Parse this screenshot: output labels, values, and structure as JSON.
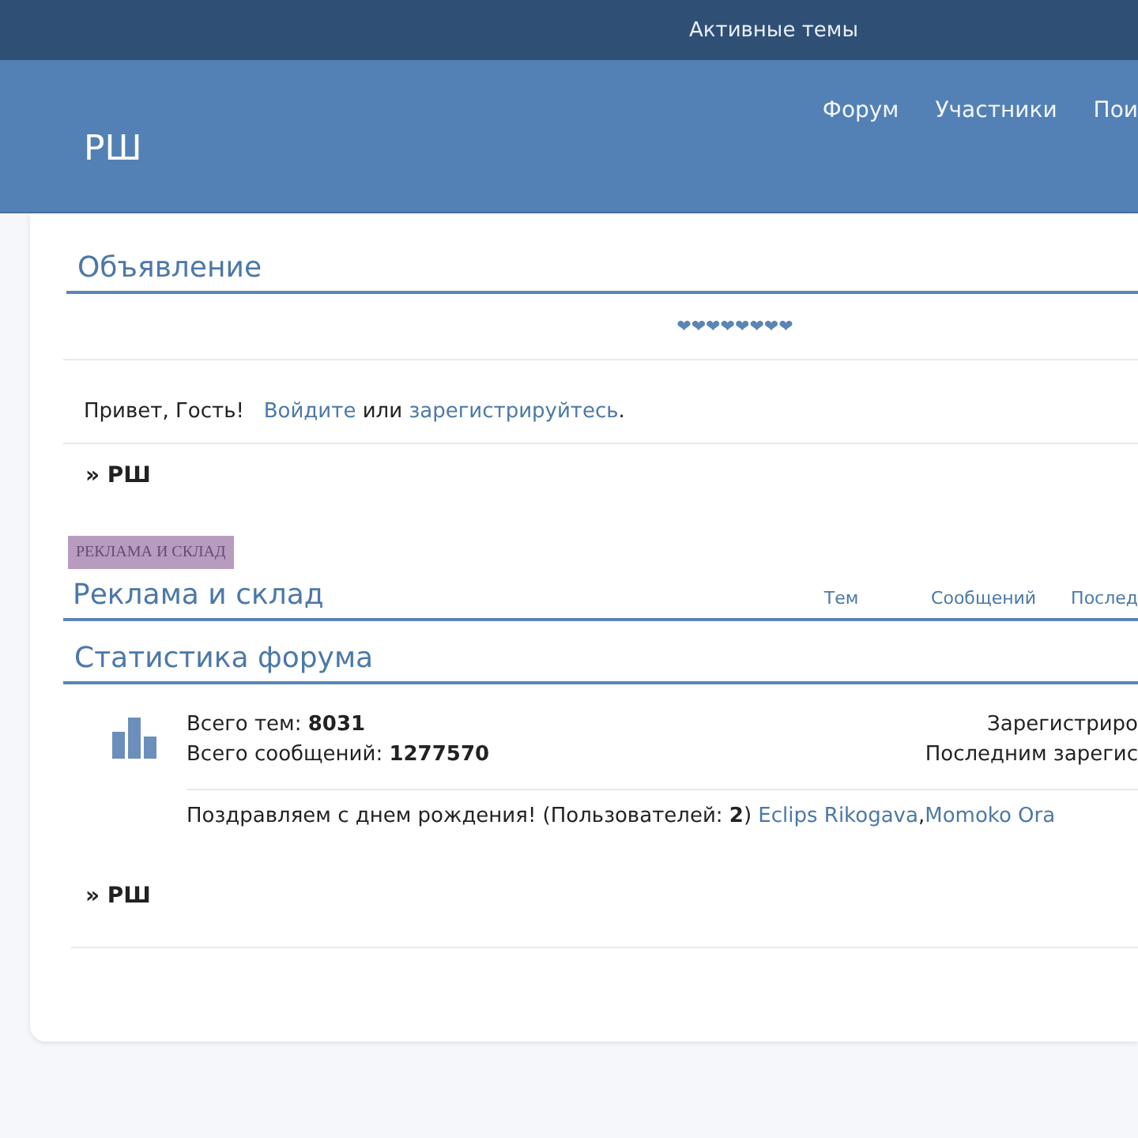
{
  "top_bar": {
    "link": "Активные темы"
  },
  "header": {
    "logo": "РШ",
    "nav": [
      {
        "label": "Форум"
      },
      {
        "label": "Участники"
      },
      {
        "label": "Пои"
      }
    ]
  },
  "announcement": {
    "title": "Объявление",
    "hearts": "❤❤❤❤❤❤❤❤"
  },
  "greeting": {
    "text": "Привет, Гость!",
    "login": "Войдите",
    "or": "или",
    "register": "зарегистрируйтесь",
    "end": "."
  },
  "breadcrumb_top": "» РШ",
  "category": {
    "tag": "РЕКЛАМА И СКЛАД",
    "title": "Реклама и склад",
    "columns": [
      "Тем",
      "Сообщений",
      "Послед"
    ]
  },
  "stats": {
    "title": "Статистика форума",
    "left": [
      "Всего тем: **8031**",
      "Всего сообщений: **1277570**"
    ],
    "right": [
      "Зарегистриро",
      "Последним зарегис"
    ],
    "birthday": {
      "text": "Поздравляем с днем рождения! (Пользователей: **2**)",
      "users": [
        "Eclips Rikogava",
        "Momoko Ora"
      ],
      "separator": ","
    }
  },
  "breadcrumb_bottom": "» РШ"
}
